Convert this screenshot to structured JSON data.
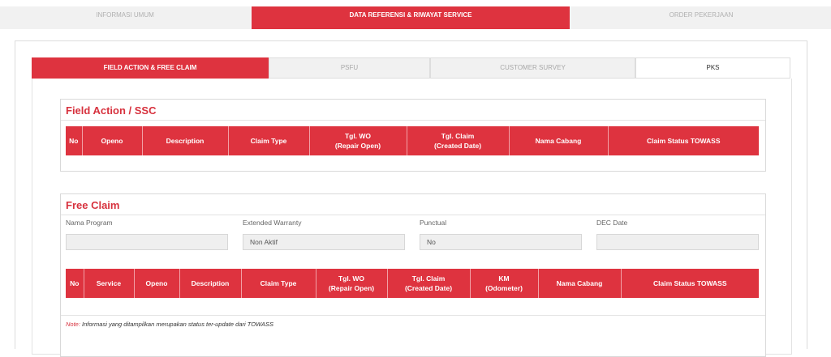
{
  "top_tabs": [
    {
      "label": "INFORMASI UMUM"
    },
    {
      "label": "DATA REFERENSI & RIWAYAT SERVICE"
    },
    {
      "label": "ORDER PEKERJAAN"
    }
  ],
  "sub_tabs": [
    {
      "label": "FIELD ACTION & FREE CLAIM"
    },
    {
      "label": "PSFU"
    },
    {
      "label": "CUSTOMER SURVEY"
    },
    {
      "label": "PKS"
    }
  ],
  "field_action": {
    "title": "Field Action / SSC",
    "columns": [
      {
        "l1": "No",
        "l2": ""
      },
      {
        "l1": "Openo",
        "l2": ""
      },
      {
        "l1": "Description",
        "l2": ""
      },
      {
        "l1": "Claim Type",
        "l2": ""
      },
      {
        "l1": "Tgl. WO",
        "l2": "(Repair Open)"
      },
      {
        "l1": "Tgl. Claim",
        "l2": "(Created Date)"
      },
      {
        "l1": "Nama Cabang",
        "l2": ""
      },
      {
        "l1": "Claim Status TOWASS",
        "l2": ""
      }
    ]
  },
  "free_claim": {
    "title": "Free Claim",
    "fields": [
      {
        "label": "Nama Program",
        "value": ""
      },
      {
        "label": "Extended Warranty",
        "value": "Non Aktif"
      },
      {
        "label": "Punctual",
        "value": "No"
      },
      {
        "label": "DEC Date",
        "value": ""
      }
    ],
    "columns": [
      {
        "l1": "No",
        "l2": ""
      },
      {
        "l1": "Service",
        "l2": ""
      },
      {
        "l1": "Openo",
        "l2": ""
      },
      {
        "l1": "Description",
        "l2": ""
      },
      {
        "l1": "Claim Type",
        "l2": ""
      },
      {
        "l1": "Tgl. WO",
        "l2": "(Repair Open)"
      },
      {
        "l1": "Tgl. Claim",
        "l2": "(Created Date)"
      },
      {
        "l1": "KM",
        "l2": "(Odometer)"
      },
      {
        "l1": "Nama Cabang",
        "l2": ""
      },
      {
        "l1": "Claim Status TOWASS",
        "l2": ""
      }
    ],
    "note_label": "Note:",
    "note_text": "Informasi yang ditampilkan merupakan status ter-update dari TOWASS"
  }
}
